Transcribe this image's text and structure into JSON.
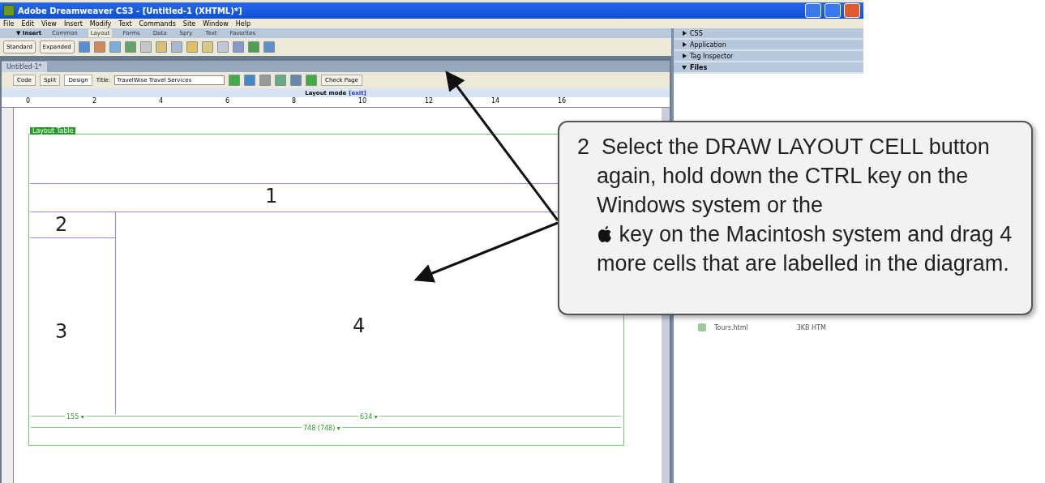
{
  "window": {
    "title": "Adobe Dreamweaver CS3 - [Untitled-1 (XHTML)*]"
  },
  "menu": [
    "File",
    "Edit",
    "View",
    "Insert",
    "Modify",
    "Text",
    "Commands",
    "Site",
    "Window",
    "Help"
  ],
  "insert_bar": {
    "label": "▼ Insert",
    "tabs": [
      {
        "label": "Common",
        "selected": false
      },
      {
        "label": "Layout",
        "selected": true
      },
      {
        "label": "Forms",
        "selected": false
      },
      {
        "label": "Data",
        "selected": false
      },
      {
        "label": "Spry",
        "selected": false
      },
      {
        "label": "Text",
        "selected": false
      },
      {
        "label": "Favorites",
        "selected": false
      }
    ],
    "mode_buttons": [
      {
        "label": "Standard",
        "selected": false
      },
      {
        "label": "Expanded",
        "selected": false
      }
    ]
  },
  "panels": [
    {
      "label": "CSS",
      "expanded": false
    },
    {
      "label": "Application",
      "expanded": false
    },
    {
      "label": "Tag Inspector",
      "expanded": false
    },
    {
      "label": "Files",
      "expanded": true
    }
  ],
  "files": [
    {
      "name": "Tours.html",
      "size": "3KB HTM"
    }
  ],
  "document": {
    "tab": "Untitled-1*",
    "views": [
      {
        "label": "Code",
        "selected": false
      },
      {
        "label": "Split",
        "selected": false
      },
      {
        "label": "Design",
        "selected": true
      }
    ],
    "title_label": "Title:",
    "title_value": "TravelWise Travel Services",
    "check_page": "Check Page",
    "layout_mode": "Layout mode",
    "exit": "[exit]",
    "ruler": [
      "0",
      "2",
      "4",
      "6",
      "8",
      "10",
      "12",
      "14",
      "16"
    ],
    "table_tab": "Layout Table"
  },
  "cells": [
    {
      "label": "1"
    },
    {
      "label": "2"
    },
    {
      "label": "3"
    },
    {
      "label": "4"
    }
  ],
  "widths": {
    "left": "155 ▾",
    "right": "634 ▾",
    "total": "748 (748) ▾"
  },
  "callout": {
    "number": "2",
    "text_before": "Select the DRAW LAYOUT CELL button again, hold down the CTRL key on the Windows system or the",
    "text_after": "key on the Macintosh system and drag 4 more cells that are labelled in the diagram."
  }
}
